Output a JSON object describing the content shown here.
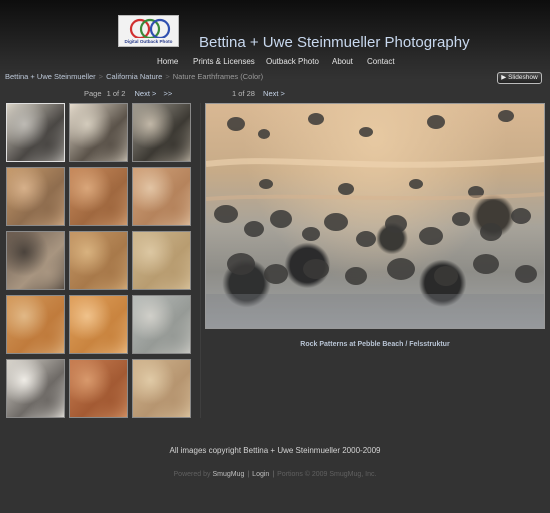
{
  "header": {
    "logo_text": "Digital Outback Photo",
    "site_title": "Bettina + Uwe Steinmueller Photography"
  },
  "nav": {
    "items": [
      "Home",
      "Prints & Licenses",
      "Outback Photo",
      "About",
      "Contact"
    ]
  },
  "breadcrumb": {
    "items": [
      "Bettina + Uwe Steinmueller",
      "California Nature",
      "Nature Earthframes (Color)"
    ],
    "separator": ">"
  },
  "slideshow_button": {
    "icon": "play-icon",
    "label": "Slideshow"
  },
  "thumbnail_pager": {
    "page_label": "Page",
    "page_value": "1 of 2",
    "next_label": "Next >",
    "last_label": ">>"
  },
  "photo_pager": {
    "position": "1 of 28",
    "next_label": "Next >"
  },
  "thumbnails": [
    {
      "colors": [
        "#d9d3c6",
        "#4a4744",
        "#bdbab4"
      ]
    },
    {
      "colors": [
        "#e6dccd",
        "#5b534a",
        "#d3cbbc"
      ]
    },
    {
      "colors": [
        "#9f9a8f",
        "#3c3933",
        "#c1b7a7"
      ]
    },
    {
      "colors": [
        "#c69a6b",
        "#8f6d4e",
        "#d6b08a"
      ]
    },
    {
      "colors": [
        "#c88a5c",
        "#a0683f",
        "#d9a67a"
      ]
    },
    {
      "colors": [
        "#d1a27a",
        "#b5835c",
        "#e2c4a4"
      ]
    },
    {
      "colors": [
        "#6b5c50",
        "#a89580",
        "#4b433c"
      ]
    },
    {
      "colors": [
        "#c49766",
        "#a8794a",
        "#d8b27f"
      ]
    },
    {
      "colors": [
        "#cdb68e",
        "#b89c70",
        "#dcc7a2"
      ]
    },
    {
      "colors": [
        "#d49a5c",
        "#c07b3c",
        "#e1b886"
      ]
    },
    {
      "colors": [
        "#e0a05c",
        "#c9843f",
        "#f0c28b"
      ]
    },
    {
      "colors": [
        "#b8bcb9",
        "#969a96",
        "#d0cfc9"
      ]
    },
    {
      "colors": [
        "#d8d4cc",
        "#6e6a66",
        "#efece6"
      ]
    },
    {
      "colors": [
        "#c87e52",
        "#a35a33",
        "#d8996c"
      ]
    },
    {
      "colors": [
        "#d0b48e",
        "#b69570",
        "#e0caa6"
      ]
    }
  ],
  "main_photo": {
    "caption": "Rock Patterns at Pebble Beach / Felsstruktur"
  },
  "footer": {
    "copyright": "All images copyright Bettina + Uwe Steinmueller 2000-2009",
    "powered_by": "Powered by",
    "smugmug": "SmugMug",
    "login": "Login",
    "portions": "Portions © 2009 SmugMug, Inc."
  },
  "colors": {
    "link": "#c4d2e6",
    "title": "#c8d8ee",
    "background": "#333333"
  }
}
